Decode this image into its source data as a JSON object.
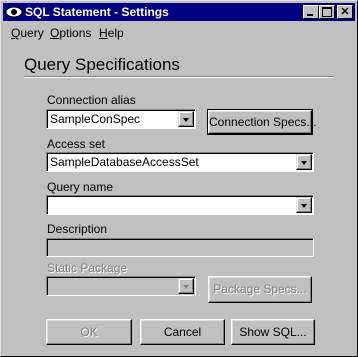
{
  "window": {
    "title": "SQL Statement - Settings",
    "icon": "eye-icon",
    "controls": [
      "minimize-icon",
      "maximize-icon",
      "close-icon"
    ]
  },
  "menu": [
    {
      "label": "Query",
      "accel": "Q",
      "rest": "uery"
    },
    {
      "label": "Options",
      "accel": "O",
      "rest": "ptions"
    },
    {
      "label": "Help",
      "accel": "H",
      "rest": "elp"
    }
  ],
  "heading": "Query Specifications",
  "connection": {
    "label": "Connection alias",
    "value": "SampleConSpec",
    "button": "Connection Specs..."
  },
  "access_set": {
    "label": "Access set",
    "value": "SampleDatabaseAccessSet"
  },
  "query_name": {
    "label": "Query name",
    "value": ""
  },
  "description": {
    "label": "Description",
    "value": ""
  },
  "static_package": {
    "label": "Static Package",
    "value": "",
    "button": "Package Specs..."
  },
  "buttons": {
    "ok": "OK",
    "cancel": "Cancel",
    "show_sql": "Show SQL..."
  }
}
